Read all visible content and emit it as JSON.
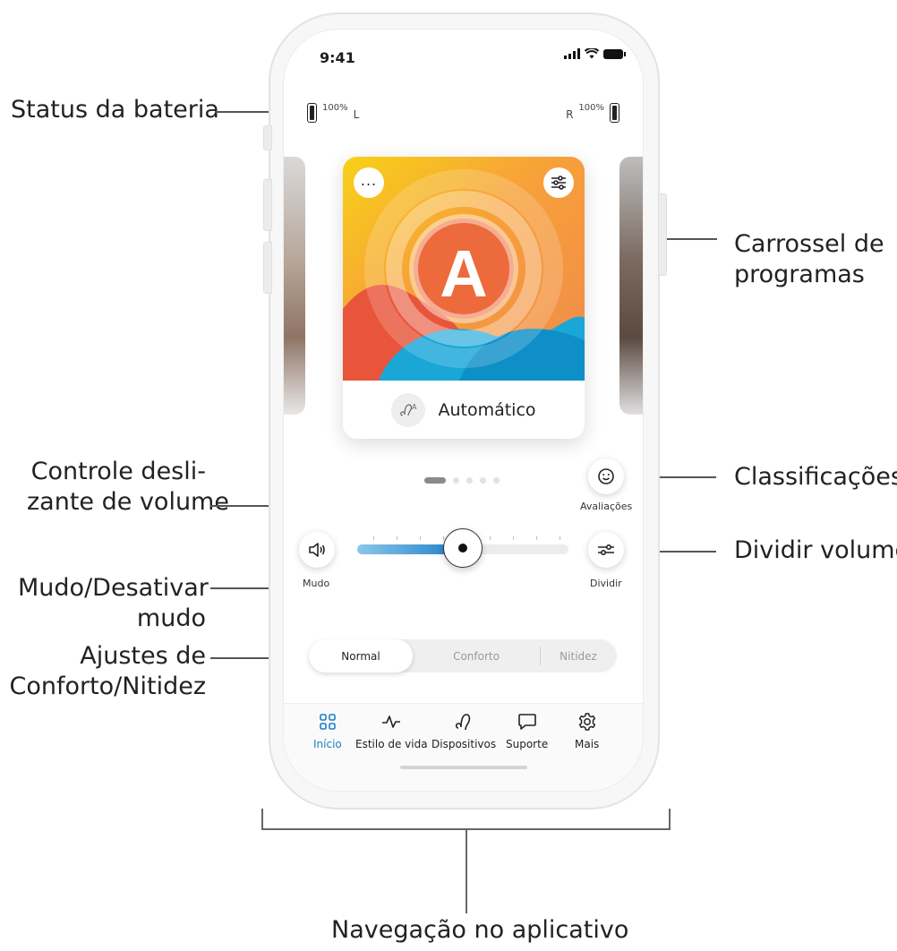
{
  "callouts": {
    "battery_status": "Status da bateria",
    "program_carousel_1": "Carrossel de",
    "program_carousel_2": "programas",
    "volume_slider_1": "Controle desli-",
    "volume_slider_2": "zante de volume",
    "ratings": "Classificações",
    "mute_1": "Mudo/Desativar",
    "mute_2": "mudo",
    "split_volume": "Dividir volume",
    "comfort_1": "Ajustes de",
    "comfort_2": "Conforto/Nitidez",
    "navigation": "Navegação no aplicativo"
  },
  "status_bar": {
    "time": "9:41"
  },
  "hearing_battery": {
    "left": {
      "percent": "100%",
      "side": "L",
      "level": 1.0
    },
    "right": {
      "percent": "100%",
      "side": "R",
      "level": 1.0
    }
  },
  "program_card": {
    "letter": "A",
    "name": "Automático",
    "more_icon": "ellipsis-icon",
    "settings_icon": "sliders-icon",
    "program_icon": "hearing-aid-auto-icon"
  },
  "pager": {
    "count": 5,
    "active_index": 0
  },
  "buttons": {
    "ratings": {
      "label": "Avaliações",
      "icon": "smiley-icon"
    },
    "mute": {
      "label": "Mudo",
      "icon": "speaker-icon"
    },
    "split": {
      "label": "Dividir",
      "icon": "split-sliders-icon"
    }
  },
  "volume": {
    "level": 0.5,
    "accent_start": "#8bc6ea",
    "accent_end": "#1e7ec8"
  },
  "sound_modes": {
    "items": [
      "Normal",
      "Conforto",
      "Nitidez"
    ],
    "selected": "Normal"
  },
  "nav": {
    "active_color": "#1e7ec8",
    "items": [
      {
        "label": "Início",
        "icon": "grid-icon"
      },
      {
        "label": "Estilo de vida",
        "icon": "pulse-icon"
      },
      {
        "label": "Dispositivos",
        "icon": "hearing-aid-icon"
      },
      {
        "label": "Suporte",
        "icon": "chat-icon"
      },
      {
        "label": "Mais",
        "icon": "gear-icon"
      }
    ]
  }
}
